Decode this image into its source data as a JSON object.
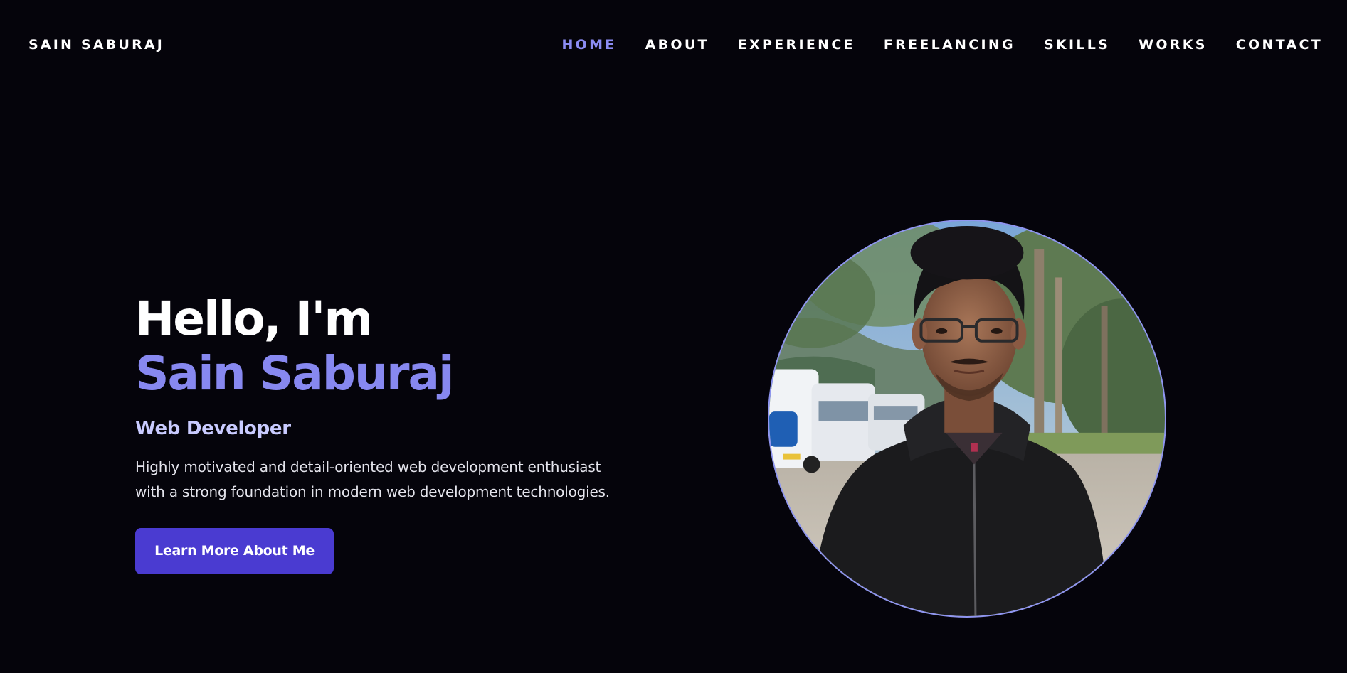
{
  "nav": {
    "brand": "SAIN SABURAJ",
    "links": [
      {
        "label": "HOME",
        "active": true
      },
      {
        "label": "ABOUT",
        "active": false
      },
      {
        "label": "EXPERIENCE",
        "active": false
      },
      {
        "label": "FREELANCING",
        "active": false
      },
      {
        "label": "SKILLS",
        "active": false
      },
      {
        "label": "WORKS",
        "active": false
      },
      {
        "label": "CONTACT",
        "active": false
      }
    ]
  },
  "hero": {
    "greeting": "Hello, I'm",
    "name": "Sain Saburaj",
    "role": "Web Developer",
    "description": "Highly motivated and detail-oriented web development enthusiast with a strong foundation in modern web development technologies.",
    "cta_label": "Learn More About Me"
  },
  "colors": {
    "background": "#05040b",
    "accent": "#8788f0",
    "role_text": "#c9cbff",
    "button": "#4a3bd1"
  }
}
